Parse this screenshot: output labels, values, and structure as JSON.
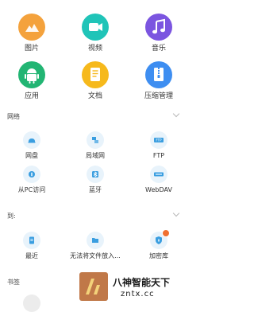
{
  "categories": [
    {
      "label": "图片",
      "icon": "mountain-picture-icon",
      "color": "#f4a23c"
    },
    {
      "label": "视频",
      "icon": "video-camera-icon",
      "color": "#20c4b8"
    },
    {
      "label": "音乐",
      "icon": "music-note-icon",
      "color": "#7b55e0"
    },
    {
      "label": "应用",
      "icon": "android-icon",
      "color": "#22b573"
    },
    {
      "label": "文档",
      "icon": "document-icon",
      "color": "#f6b91c"
    },
    {
      "label": "压缩管理",
      "icon": "archive-zip-icon",
      "color": "#3e8ef1"
    }
  ],
  "network": {
    "title": "网络",
    "items": [
      {
        "label": "网盘",
        "icon": "cloud-drive-icon"
      },
      {
        "label": "局域网",
        "icon": "lan-icon"
      },
      {
        "label": "FTP",
        "icon": "ftp-icon",
        "icon_text": "FTP"
      },
      {
        "label": "从PC访问",
        "icon": "pc-access-icon"
      },
      {
        "label": "蓝牙",
        "icon": "bluetooth-icon"
      },
      {
        "label": "WebDAV",
        "icon": "webdav-icon"
      }
    ]
  },
  "shortcuts": {
    "title": "到:",
    "items": [
      {
        "label": "最近",
        "icon": "recent-document-icon"
      },
      {
        "label": "无法将文件放入...",
        "icon": "folder-icon"
      },
      {
        "label": "加密库",
        "icon": "encrypted-vault-icon",
        "badge": true
      }
    ]
  },
  "bookmarks": {
    "title": "书签"
  },
  "watermark": {
    "title": "八神智能天下",
    "url": "zntx.cc"
  },
  "colors": {
    "accent": "#3a9ee0",
    "small_icon_bg": "#e8f3fb",
    "badge": "#f07030"
  }
}
